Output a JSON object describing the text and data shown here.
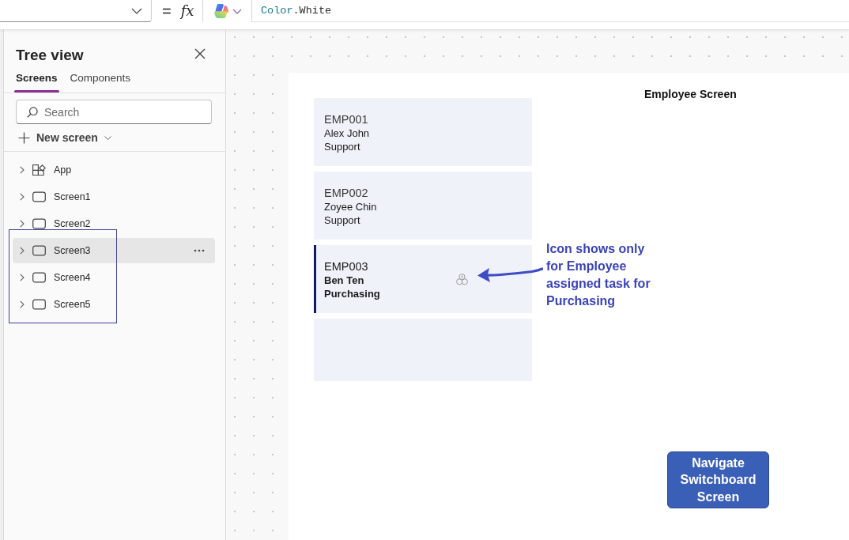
{
  "formula_bar": {
    "equals_sign": "=",
    "function_symbol": "fx",
    "formula": [
      {
        "text": "Color",
        "kind": "enum"
      },
      {
        "text": ".White",
        "kind": "plain"
      }
    ]
  },
  "tree_view": {
    "title": "Tree view",
    "tabs": [
      {
        "label": "Screens",
        "selected": true
      },
      {
        "label": "Components",
        "selected": false
      }
    ],
    "search": {
      "placeholder": "Search"
    },
    "new_screen": "New screen",
    "items": [
      {
        "label": "App",
        "kind": "app",
        "expanded": false,
        "selected": false
      },
      {
        "label": "Screen1",
        "kind": "screen",
        "expanded": false,
        "selected": false
      },
      {
        "label": "Screen2",
        "kind": "screen",
        "expanded": false,
        "selected": false
      },
      {
        "label": "Screen3",
        "kind": "screen",
        "expanded": false,
        "selected": true
      },
      {
        "label": "Screen4",
        "kind": "screen",
        "expanded": false,
        "selected": false
      },
      {
        "label": "Screen5",
        "kind": "screen",
        "expanded": false,
        "selected": false
      }
    ]
  },
  "canvas": {
    "screen_title": "Employee Screen",
    "gallery": [
      {
        "id": "EMP001",
        "name": "Alex John",
        "department": "Support",
        "selected": false,
        "shows_icon": false
      },
      {
        "id": "EMP002",
        "name": "Zoyee Chin",
        "department": "Support",
        "selected": false,
        "shows_icon": false
      },
      {
        "id": "EMP003",
        "name": "Ben Ten",
        "department": "Purchasing",
        "selected": true,
        "shows_icon": true
      },
      {
        "selected": false,
        "shows_icon": false
      }
    ],
    "annotation": "Icon shows only for Employee assigned task for Purchasing",
    "button": "Navigate Switchboard Screen"
  }
}
